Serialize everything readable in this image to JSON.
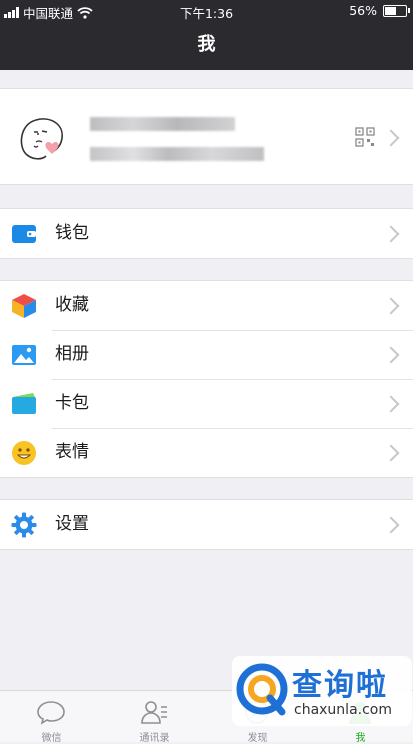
{
  "status_bar": {
    "carrier": "中国联通",
    "time": "下午1:36",
    "battery": "56%",
    "battery_level": 0.56
  },
  "nav": {
    "title": "我"
  },
  "menu_groups": [
    {
      "items": [
        {
          "label": "钱包",
          "icon": "wallet-icon"
        }
      ]
    },
    {
      "items": [
        {
          "label": "收藏",
          "icon": "favorites-cube-icon"
        },
        {
          "label": "相册",
          "icon": "album-icon"
        },
        {
          "label": "卡包",
          "icon": "card-pack-icon"
        },
        {
          "label": "表情",
          "icon": "emoji-smile-icon"
        }
      ]
    },
    {
      "items": [
        {
          "label": "设置",
          "icon": "settings-gear-icon"
        }
      ]
    }
  ],
  "tab_bar": [
    {
      "label": "微信",
      "icon": "chat-bubble-icon"
    },
    {
      "label": "通讯录",
      "icon": "contacts-icon"
    },
    {
      "label": "发现",
      "icon": "discover-icon"
    },
    {
      "label": "我",
      "icon": "me-icon",
      "active": true
    }
  ],
  "watermark": {
    "text": "查询啦",
    "url": "chaxunla.com"
  },
  "colors": {
    "nav_bg": "#2b2b2f",
    "page_bg": "#efeff4",
    "active_tab": "#1aad19",
    "watermark_blue": "#1e6fd6"
  }
}
